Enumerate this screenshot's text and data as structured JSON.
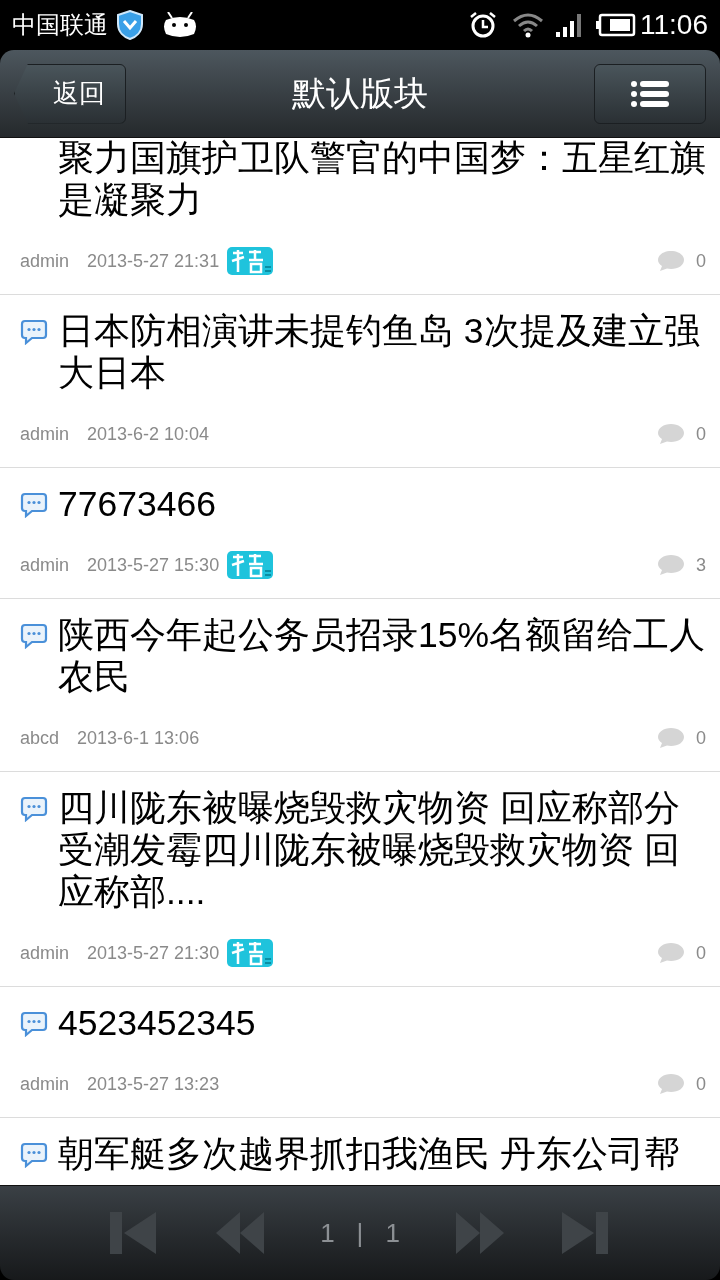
{
  "status_bar": {
    "carrier": "中国联通",
    "time": "11:06"
  },
  "header": {
    "back": "返回",
    "title": "默认版块"
  },
  "posts": [
    {
      "has_icon": false,
      "title": "聚力国旗护卫队警官的中国梦：五星红旗是凝聚力",
      "author": "admin",
      "time": "2013-5-27 21:31",
      "featured": true,
      "comments": "0"
    },
    {
      "has_icon": true,
      "title": "日本防相演讲未提钓鱼岛 3次提及建立强大日本",
      "author": "admin",
      "time": "2013-6-2 10:04",
      "featured": false,
      "comments": "0"
    },
    {
      "has_icon": true,
      "title": "77673466",
      "author": "admin",
      "time": "2013-5-27 15:30",
      "featured": true,
      "comments": "3"
    },
    {
      "has_icon": true,
      "title": "陕西今年起公务员招录15%名额留给工人农民",
      "author": "abcd",
      "time": "2013-6-1 13:06",
      "featured": false,
      "comments": "0"
    },
    {
      "has_icon": true,
      "title": "四川陇东被曝烧毁救灾物资 回应称部分受潮发霉四川陇东被曝烧毁救灾物资 回应称部....",
      "author": "admin",
      "time": "2013-5-27 21:30",
      "featured": true,
      "comments": "0"
    },
    {
      "has_icon": true,
      "title": "4523452345",
      "author": "admin",
      "time": "2013-5-27 13:23",
      "featured": false,
      "comments": "0"
    },
    {
      "has_icon": true,
      "title": "朝军艇多次越界抓扣我渔民 丹东公司帮"
    }
  ],
  "pager": {
    "current": "1",
    "separator": "|",
    "total": "1",
    "buttons": [
      {
        "kind": "first",
        "disabled": true
      },
      {
        "kind": "prev",
        "disabled": true
      },
      {
        "kind": "next",
        "disabled": true
      },
      {
        "kind": "last",
        "disabled": true
      }
    ]
  }
}
